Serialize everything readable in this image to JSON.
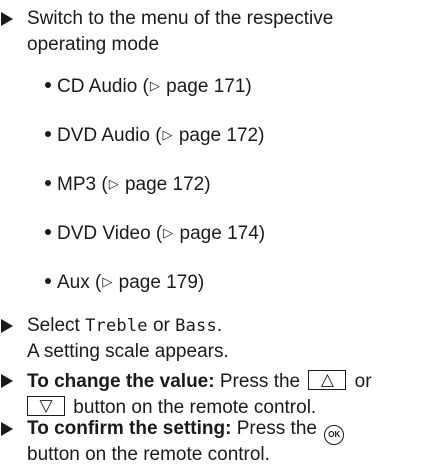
{
  "steps": {
    "switch_menu": {
      "line1": "Switch to the menu of the respective",
      "line2": "operating mode"
    },
    "sub_items": [
      {
        "label": "CD Audio (",
        "ref_symbol": "▷",
        "page": " page 171)"
      },
      {
        "label": "DVD Audio (",
        "ref_symbol": "▷",
        "page": " page 172)"
      },
      {
        "label": "MP3 (",
        "ref_symbol": "▷",
        "page": " page 172)"
      },
      {
        "label": "DVD Video (",
        "ref_symbol": "▷",
        "page": " page 174)"
      },
      {
        "label": "Aux (",
        "ref_symbol": "▷",
        "page": " page 179)"
      }
    ],
    "select": {
      "prefix": "Select ",
      "option1": "Treble",
      "connector": " or ",
      "option2": "Bass",
      "suffix": ".",
      "result": "A setting scale appears."
    },
    "change_value": {
      "bold_label": "To change the value:",
      "text1": " Press the ",
      "key_up": "△",
      "text_or": " or",
      "key_down": "▽",
      "text2": " button on the remote control."
    },
    "confirm": {
      "bold_label": "To confirm the setting:",
      "text1": " Press the ",
      "ok_key": "OK",
      "line2": "button on the remote control."
    }
  }
}
